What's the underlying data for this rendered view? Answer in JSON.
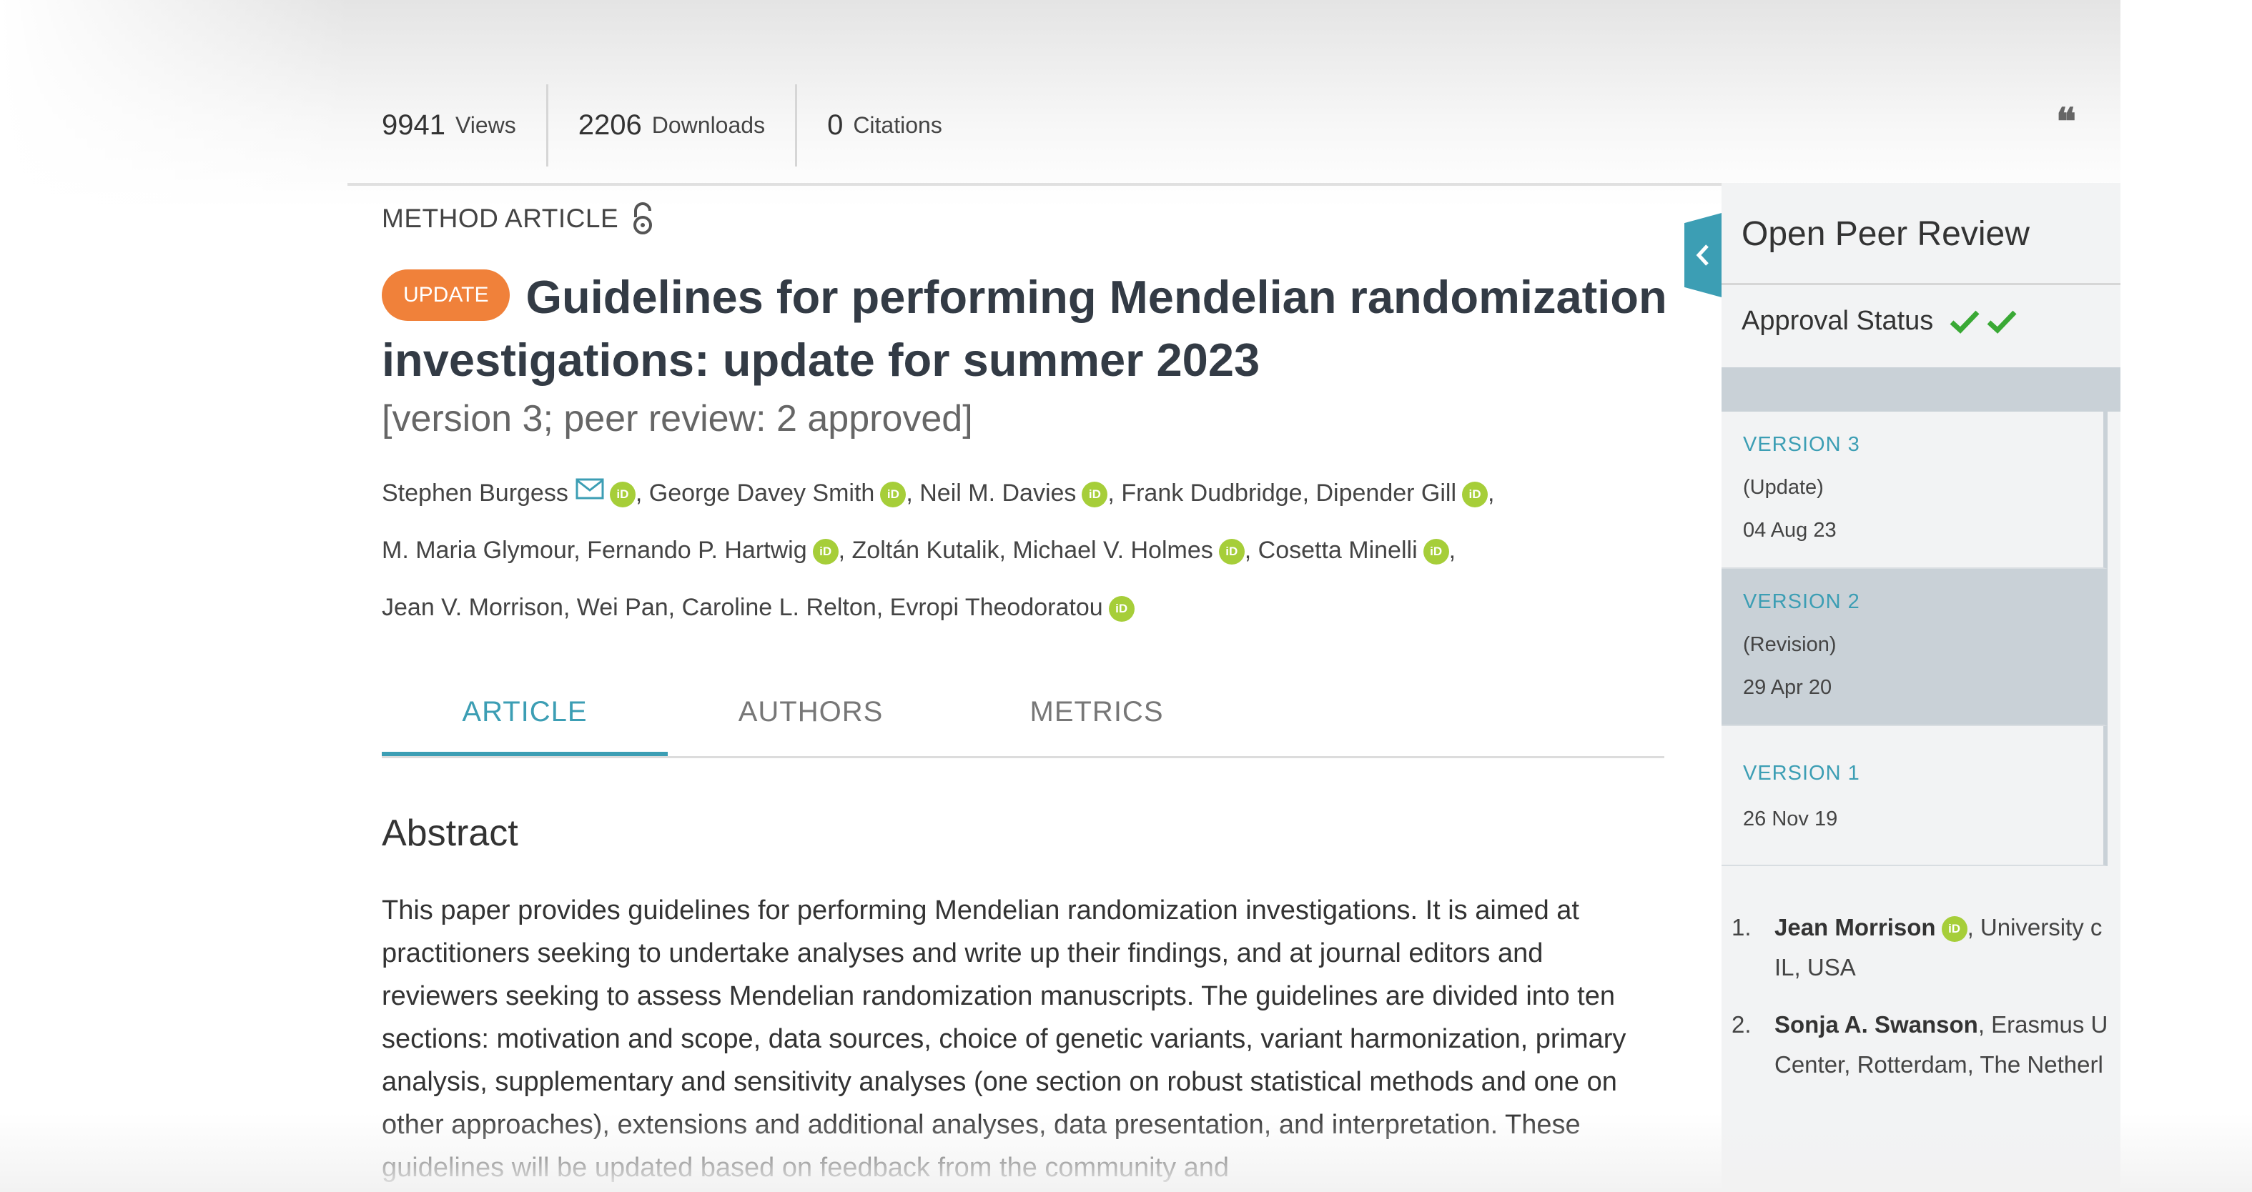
{
  "metrics": {
    "views": {
      "value": "9941",
      "label": "Views"
    },
    "downloads": {
      "value": "2206",
      "label": "Downloads"
    },
    "citations": {
      "value": "0",
      "label": "Citations"
    },
    "cite_icon": "quote-icon"
  },
  "article": {
    "type_label": "METHOD ARTICLE",
    "update_badge": "UPDATE",
    "title": "Guidelines for performing Mendelian randomization investigations: update for summer 2023",
    "version_note": "[version 3; peer review: 2 approved]",
    "authors": [
      {
        "name": "Stephen Burgess",
        "mail": true,
        "orcid": true
      },
      {
        "name": "George Davey Smith",
        "orcid": true
      },
      {
        "name": "Neil M. Davies",
        "orcid": true
      },
      {
        "name": "Frank Dudbridge",
        "orcid": false
      },
      {
        "name": "Dipender Gill",
        "orcid": true
      },
      {
        "name": "M. Maria Glymour",
        "orcid": false
      },
      {
        "name": "Fernando P. Hartwig",
        "orcid": true
      },
      {
        "name": "Zoltán Kutalik",
        "orcid": false
      },
      {
        "name": "Michael V. Holmes",
        "orcid": true
      },
      {
        "name": "Cosetta Minelli",
        "orcid": true
      },
      {
        "name": "Jean V. Morrison",
        "orcid": false
      },
      {
        "name": "Wei Pan",
        "orcid": false
      },
      {
        "name": "Caroline L. Relton",
        "orcid": false
      },
      {
        "name": "Evropi Theodoratou",
        "orcid": true
      }
    ],
    "orcid_text": "iD"
  },
  "tabs": [
    {
      "label": "ARTICLE",
      "active": true
    },
    {
      "label": "AUTHORS",
      "active": false
    },
    {
      "label": "METRICS",
      "active": false
    }
  ],
  "abstract": {
    "heading": "Abstract",
    "text": "This paper provides guidelines for performing Mendelian randomization investigations. It is aimed at practitioners seeking to undertake analyses and write up their findings, and at journal editors and reviewers seeking to assess Mendelian randomization manuscripts. The guidelines are divided into ten sections: motivation and scope, data sources, choice of genetic variants, variant harmonization, primary analysis, supplementary and sensitivity analyses (one section on robust statistical methods and one on other approaches), extensions and additional analyses, data presentation, and interpretation. These guidelines will be updated based on feedback from the community and"
  },
  "peer_review": {
    "title": "Open Peer Review",
    "approval_label": "Approval Status",
    "versions": [
      {
        "label": "VERSION 3",
        "kind": "(Update)",
        "date": "04 Aug 23",
        "selected": false
      },
      {
        "label": "VERSION 2",
        "kind": "(Revision)",
        "date": "29 Apr 20",
        "selected": true
      },
      {
        "label": "VERSION 1",
        "kind": "",
        "date": "26 Nov 19",
        "selected": false
      }
    ],
    "reviewers": [
      {
        "index": "1.",
        "name": "Jean Morrison",
        "orcid": true,
        "line1": ", University c",
        "line2": "IL, USA"
      },
      {
        "index": "2.",
        "name": "Sonja A. Swanson",
        "orcid": false,
        "line1": ", Erasmus U",
        "line2": "Center, Rotterdam, The Netherl"
      }
    ]
  },
  "colors": {
    "accent": "#3c9eb4",
    "update_badge": "#f0813a",
    "orcid": "#a6ce39",
    "approved": "#2ca02c"
  }
}
